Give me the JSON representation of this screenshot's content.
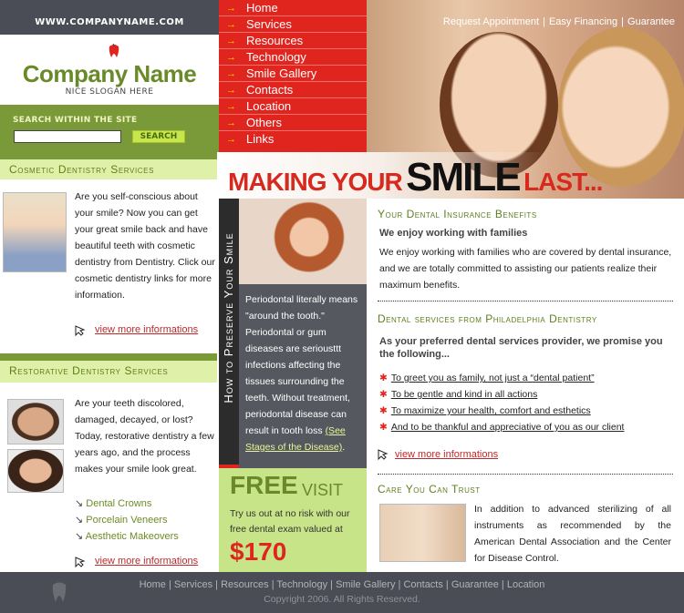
{
  "site_url": "WWW.COMPANYNAME.COM",
  "logo": {
    "company_name": "Company Name",
    "slogan": "NICE SLOGAN HERE"
  },
  "search": {
    "title": "SEARCH WITHIN THE SITE",
    "placeholder": "",
    "button_label": "SEARCH"
  },
  "nav": [
    "Home",
    "Services",
    "Resources",
    "Technology",
    "Smile Gallery",
    "Contacts",
    "Location",
    "Others",
    "Links"
  ],
  "top_links": [
    "Request Appointment",
    "Easy Financing",
    "Guarantee"
  ],
  "tagline": {
    "part1": "MAKING YOUR",
    "part2": "SMILE",
    "part3": "LAST..."
  },
  "cosmetic": {
    "heading": "Cosmetic Dentistry Services",
    "text": "Are you self-conscious about your smile? Now you can get your great smile back and have beautiful teeth with cosmetic dentistry from Dentistry. Click our cosmetic dentistry links for more information.",
    "more": "view more informations"
  },
  "restorative": {
    "heading": "Restorative Dentistry Services",
    "text": "Are your teeth discolored, damaged, decayed, or lost? Today, restorative dentistry a few years ago, and the process makes your smile look great.",
    "items": [
      "Dental Crowns",
      "Porcelain Veneers",
      "Aesthetic Makeovers"
    ],
    "more": "view more informations"
  },
  "preserve": {
    "vertical_title": "How to Preserve Your Smile",
    "text": "Periodontal literally means \"around the tooth.\" Periodontal or gum diseases are seriousttt infections affecting the tissues surrounding the teeth. Without treatment, periodontal disease can result in tooth loss",
    "link": "(See Stages of the Disease)",
    "after": "."
  },
  "free_visit": {
    "free": "FREE",
    "visit": "VISIT",
    "text": "Try us out at no risk with our free dental exam valued at",
    "price": "$170"
  },
  "insurance": {
    "heading": "Your Dental Insurance Benefits",
    "sub": "We enjoy working with families",
    "text": "We enjoy working with families who are covered by dental insurance, and we are totally committed to assisting our patients realize their maximum benefits."
  },
  "services": {
    "heading": "Dental services from Philadelphia Dentistry",
    "sub": "As your preferred dental services provider, we promise you the following...",
    "bullets": [
      "To greet you as family, not just a “dental patient”",
      "To be gentle and kind in all actions",
      "To maximize your health, comfort and esthetics",
      "And to be thankful and appreciative of you as our client"
    ],
    "more": "view more informations"
  },
  "care": {
    "heading": "Care You Can Trust",
    "text": "In addition to advanced sterilizing of all instruments as recommended by the American Dental Association and the Center for Disease Control."
  },
  "footer": {
    "links": [
      "Home",
      "Services",
      "Resources",
      "Technology",
      "Smile Gallery",
      "Contacts",
      "Guarantee",
      "Location"
    ],
    "copyright": "Copyright 2006. All Rights Reserved."
  },
  "colors": {
    "red": "#e0251f",
    "green": "#6a8a2a",
    "light_green": "#dff0a8",
    "dark_gray": "#4a4d55"
  }
}
